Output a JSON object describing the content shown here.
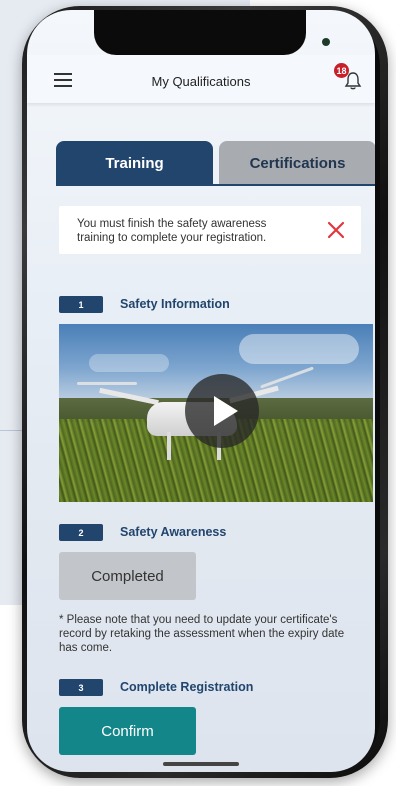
{
  "header": {
    "title": "My Qualifications",
    "notification_count": "18"
  },
  "tabs": [
    {
      "label": "Training",
      "active": true
    },
    {
      "label": "Certifications",
      "active": false
    }
  ],
  "alert": {
    "message": "You must finish the safety awareness training to complete your registration."
  },
  "steps": [
    {
      "number": "1",
      "label": "Safety Information"
    },
    {
      "number": "2",
      "label": "Safety Awareness"
    },
    {
      "number": "3",
      "label": "Complete Registration"
    }
  ],
  "video": {
    "play_icon": "play-icon"
  },
  "status": {
    "completed_label": "Completed"
  },
  "note": "* Please note that you need to update your certificate's record by retaking the assessment when the expiry date has come.",
  "actions": {
    "confirm_label": "Confirm"
  },
  "colors": {
    "primary": "#22456e",
    "accent": "#13868a",
    "alert_close": "#e0363c",
    "badge": "#c8202a",
    "inactive_tab": "#a8acb1"
  }
}
